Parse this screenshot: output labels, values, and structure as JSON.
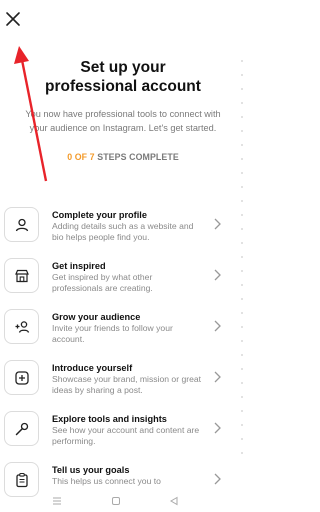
{
  "header": {
    "title": "Set up your professional account",
    "subtitle": "You now have professional tools to connect with your audience on Instagram. Let's get started.",
    "progress_count": "0 OF 7",
    "progress_suffix": " STEPS COMPLETE"
  },
  "steps": [
    {
      "title": "Complete your profile",
      "description": "Adding details such as a website and bio helps people find you.",
      "icon": "person-icon"
    },
    {
      "title": "Get inspired",
      "description": "Get inspired by what other professionals are creating.",
      "icon": "storefront-icon"
    },
    {
      "title": "Grow your audience",
      "description": "Invite your friends to follow your account.",
      "icon": "add-person-icon"
    },
    {
      "title": "Introduce yourself",
      "description": "Showcase your brand, mission or great ideas by sharing a post.",
      "icon": "add-post-icon"
    },
    {
      "title": "Explore tools and insights",
      "description": "See how your account and content are performing.",
      "icon": "tools-icon"
    },
    {
      "title": "Tell us your goals",
      "description": "This helps us connect you to",
      "icon": "clipboard-icon"
    }
  ],
  "colors": {
    "accent": "#f39a2a",
    "annotation_arrow": "#e8232a"
  }
}
